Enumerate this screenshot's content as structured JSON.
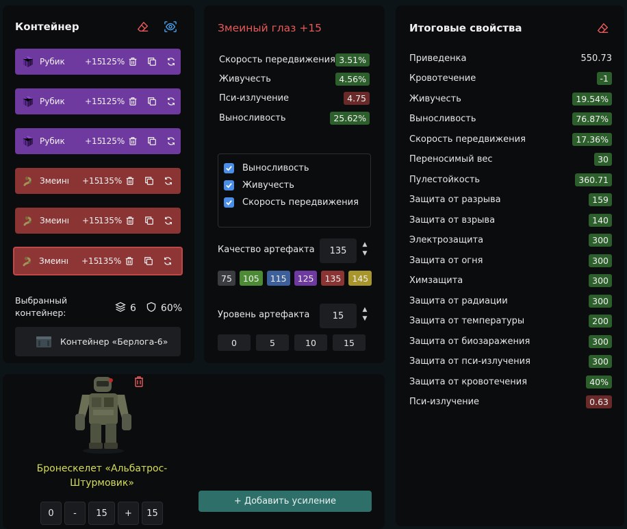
{
  "container": {
    "title": "Контейнер",
    "artifacts": [
      {
        "name": "Рубик",
        "level": "+15",
        "quality": "125%",
        "style": "purple"
      },
      {
        "name": "Рубик",
        "level": "+15",
        "quality": "125%",
        "style": "purple"
      },
      {
        "name": "Рубик",
        "level": "+15",
        "quality": "125%",
        "style": "purple"
      },
      {
        "name": "Змеины...",
        "level": "+15",
        "quality": "135%",
        "style": "red"
      },
      {
        "name": "Змеины...",
        "level": "+15",
        "quality": "135%",
        "style": "red"
      },
      {
        "name": "Змеины...",
        "level": "+15",
        "quality": "135%",
        "style": "red",
        "selected": true
      }
    ],
    "selected_label": "Выбранный контейнер:",
    "slots": "6",
    "protection": "60%",
    "container_name": "Контейнер «Берлога-6»"
  },
  "artifact": {
    "title": "Змеиный глаз +15",
    "stats": [
      {
        "name": "Скорость передвижения",
        "value": "3.51%",
        "color": "green"
      },
      {
        "name": "Живучесть",
        "value": "4.56%",
        "color": "green"
      },
      {
        "name": "Пси-излучение",
        "value": "4.75",
        "color": "red"
      },
      {
        "name": "Выносливость",
        "value": "25.62%",
        "color": "green"
      }
    ],
    "checkboxes": [
      "Выносливость",
      "Живучесть",
      "Скорость передвижения"
    ],
    "quality_label": "Качество артефакта",
    "quality_value": "135",
    "quality_presets": [
      {
        "label": "75",
        "color": "#3a3c40"
      },
      {
        "label": "105",
        "color": "#4d8a35"
      },
      {
        "label": "115",
        "color": "#3d5f9a"
      },
      {
        "label": "125",
        "color": "#6e3a9f"
      },
      {
        "label": "135",
        "color": "#8a3434"
      },
      {
        "label": "145",
        "color": "#a8962c"
      }
    ],
    "level_label": "Уровень артефакта",
    "level_value": "15",
    "level_presets": [
      "0",
      "5",
      "10",
      "15"
    ]
  },
  "summary": {
    "title": "Итоговые свойства",
    "rows": [
      {
        "name": "Приведенка",
        "value": "550.73",
        "color": "plain"
      },
      {
        "name": "Кровотечение",
        "value": "-1",
        "color": "green"
      },
      {
        "name": "Живучесть",
        "value": "19.54%",
        "color": "green"
      },
      {
        "name": "Выносливость",
        "value": "76.87%",
        "color": "green"
      },
      {
        "name": "Скорость передвижения",
        "value": "17.36%",
        "color": "green"
      },
      {
        "name": "Переносимый вес",
        "value": "30",
        "color": "green"
      },
      {
        "name": "Пулестойкость",
        "value": "360.71",
        "color": "green"
      },
      {
        "name": "Защита от разрыва",
        "value": "159",
        "color": "green"
      },
      {
        "name": "Защита от взрыва",
        "value": "140",
        "color": "green"
      },
      {
        "name": "Электрозащита",
        "value": "300",
        "color": "green"
      },
      {
        "name": "Защита от огня",
        "value": "300",
        "color": "green"
      },
      {
        "name": "Химзащита",
        "value": "300",
        "color": "green"
      },
      {
        "name": "Защита от радиации",
        "value": "300",
        "color": "green"
      },
      {
        "name": "Защита от температуры",
        "value": "200",
        "color": "green"
      },
      {
        "name": "Защита от биозаражения",
        "value": "300",
        "color": "green"
      },
      {
        "name": "Защита от пси-излучения",
        "value": "300",
        "color": "green"
      },
      {
        "name": "Защита от кровотечения",
        "value": "40%",
        "color": "green"
      },
      {
        "name": "Пси-излучение",
        "value": "0.63",
        "color": "red"
      }
    ]
  },
  "armor": {
    "name": "Бронескелет «Альбатрос-Штурмовик»",
    "controls": [
      "0",
      "-",
      "15",
      "+",
      "15"
    ],
    "add_label": "+ Добавить усиление"
  }
}
